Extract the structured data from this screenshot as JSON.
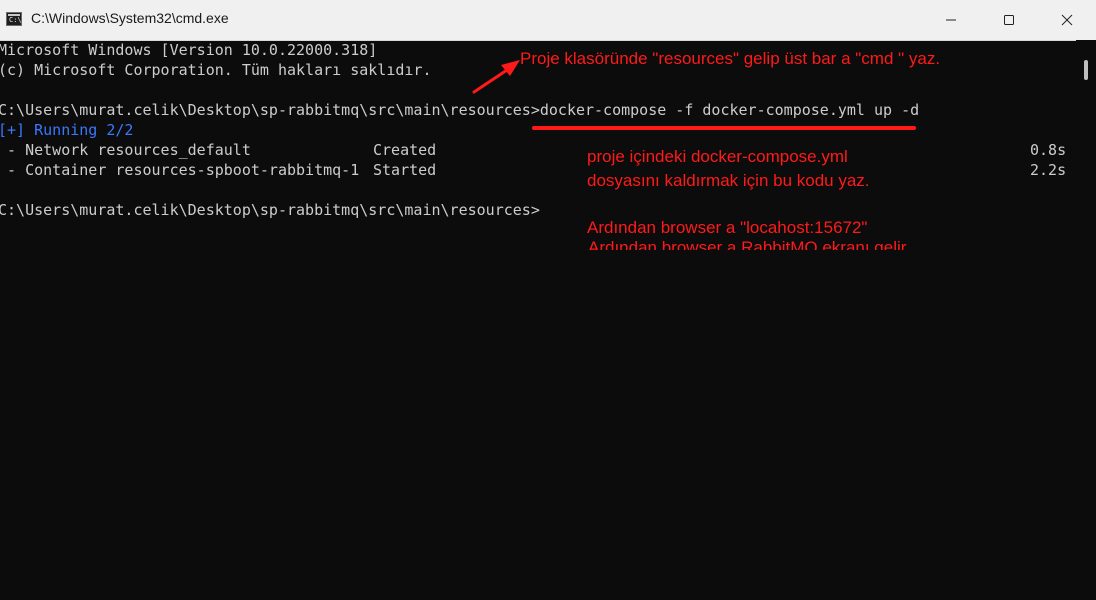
{
  "window": {
    "title": "C:\\Windows\\System32\\cmd.exe",
    "icon_text": "C:\\",
    "icon": "cmd-icon",
    "controls": [
      "minimize-icon",
      "maximize-icon",
      "close-icon"
    ]
  },
  "terminal": {
    "lines": [
      "Microsoft Windows [Version 10.0.22000.318]",
      "(c) Microsoft Corporation. Tüm hakları saklıdır.",
      "",
      "C:\\Users\\murat.celik\\Desktop\\sp-rabbitmq\\src\\main\\resources>docker-compose -f docker-compose.yml up -d",
      "[+] Running 2/2",
      "",
      "",
      "",
      "C:\\Users\\murat.celik\\Desktop\\sp-rabbitmq\\src\\main\\resources>"
    ],
    "rows": [
      {
        "name": " - Network resources_default",
        "status": "Created",
        "time": "0.8s"
      },
      {
        "name": " - Container resources-spboot-rabbitmq-1",
        "status": "Started",
        "time": "2.2s"
      }
    ]
  },
  "annotations": {
    "top": "Proje klasöründe \"resources\" gelip üst bar a \"cmd \" yaz.",
    "middle_1": "proje içindeki docker-compose.yml",
    "middle_2": "dosyasını kaldırmak için bu kodu yaz.",
    "bottom_1": "Ardından browser a \"locahost:15672\"",
    "bottom_2_partial": "Ardından browser a RabbitMQ ekranı gelir."
  },
  "colors": {
    "terminal_bg": "#0c0c0c",
    "terminal_fg": "#cccccc",
    "running_blue": "#3a78ff",
    "annotation_red": "#ff1a1a",
    "titlebar_bg": "#f0f0f0"
  }
}
